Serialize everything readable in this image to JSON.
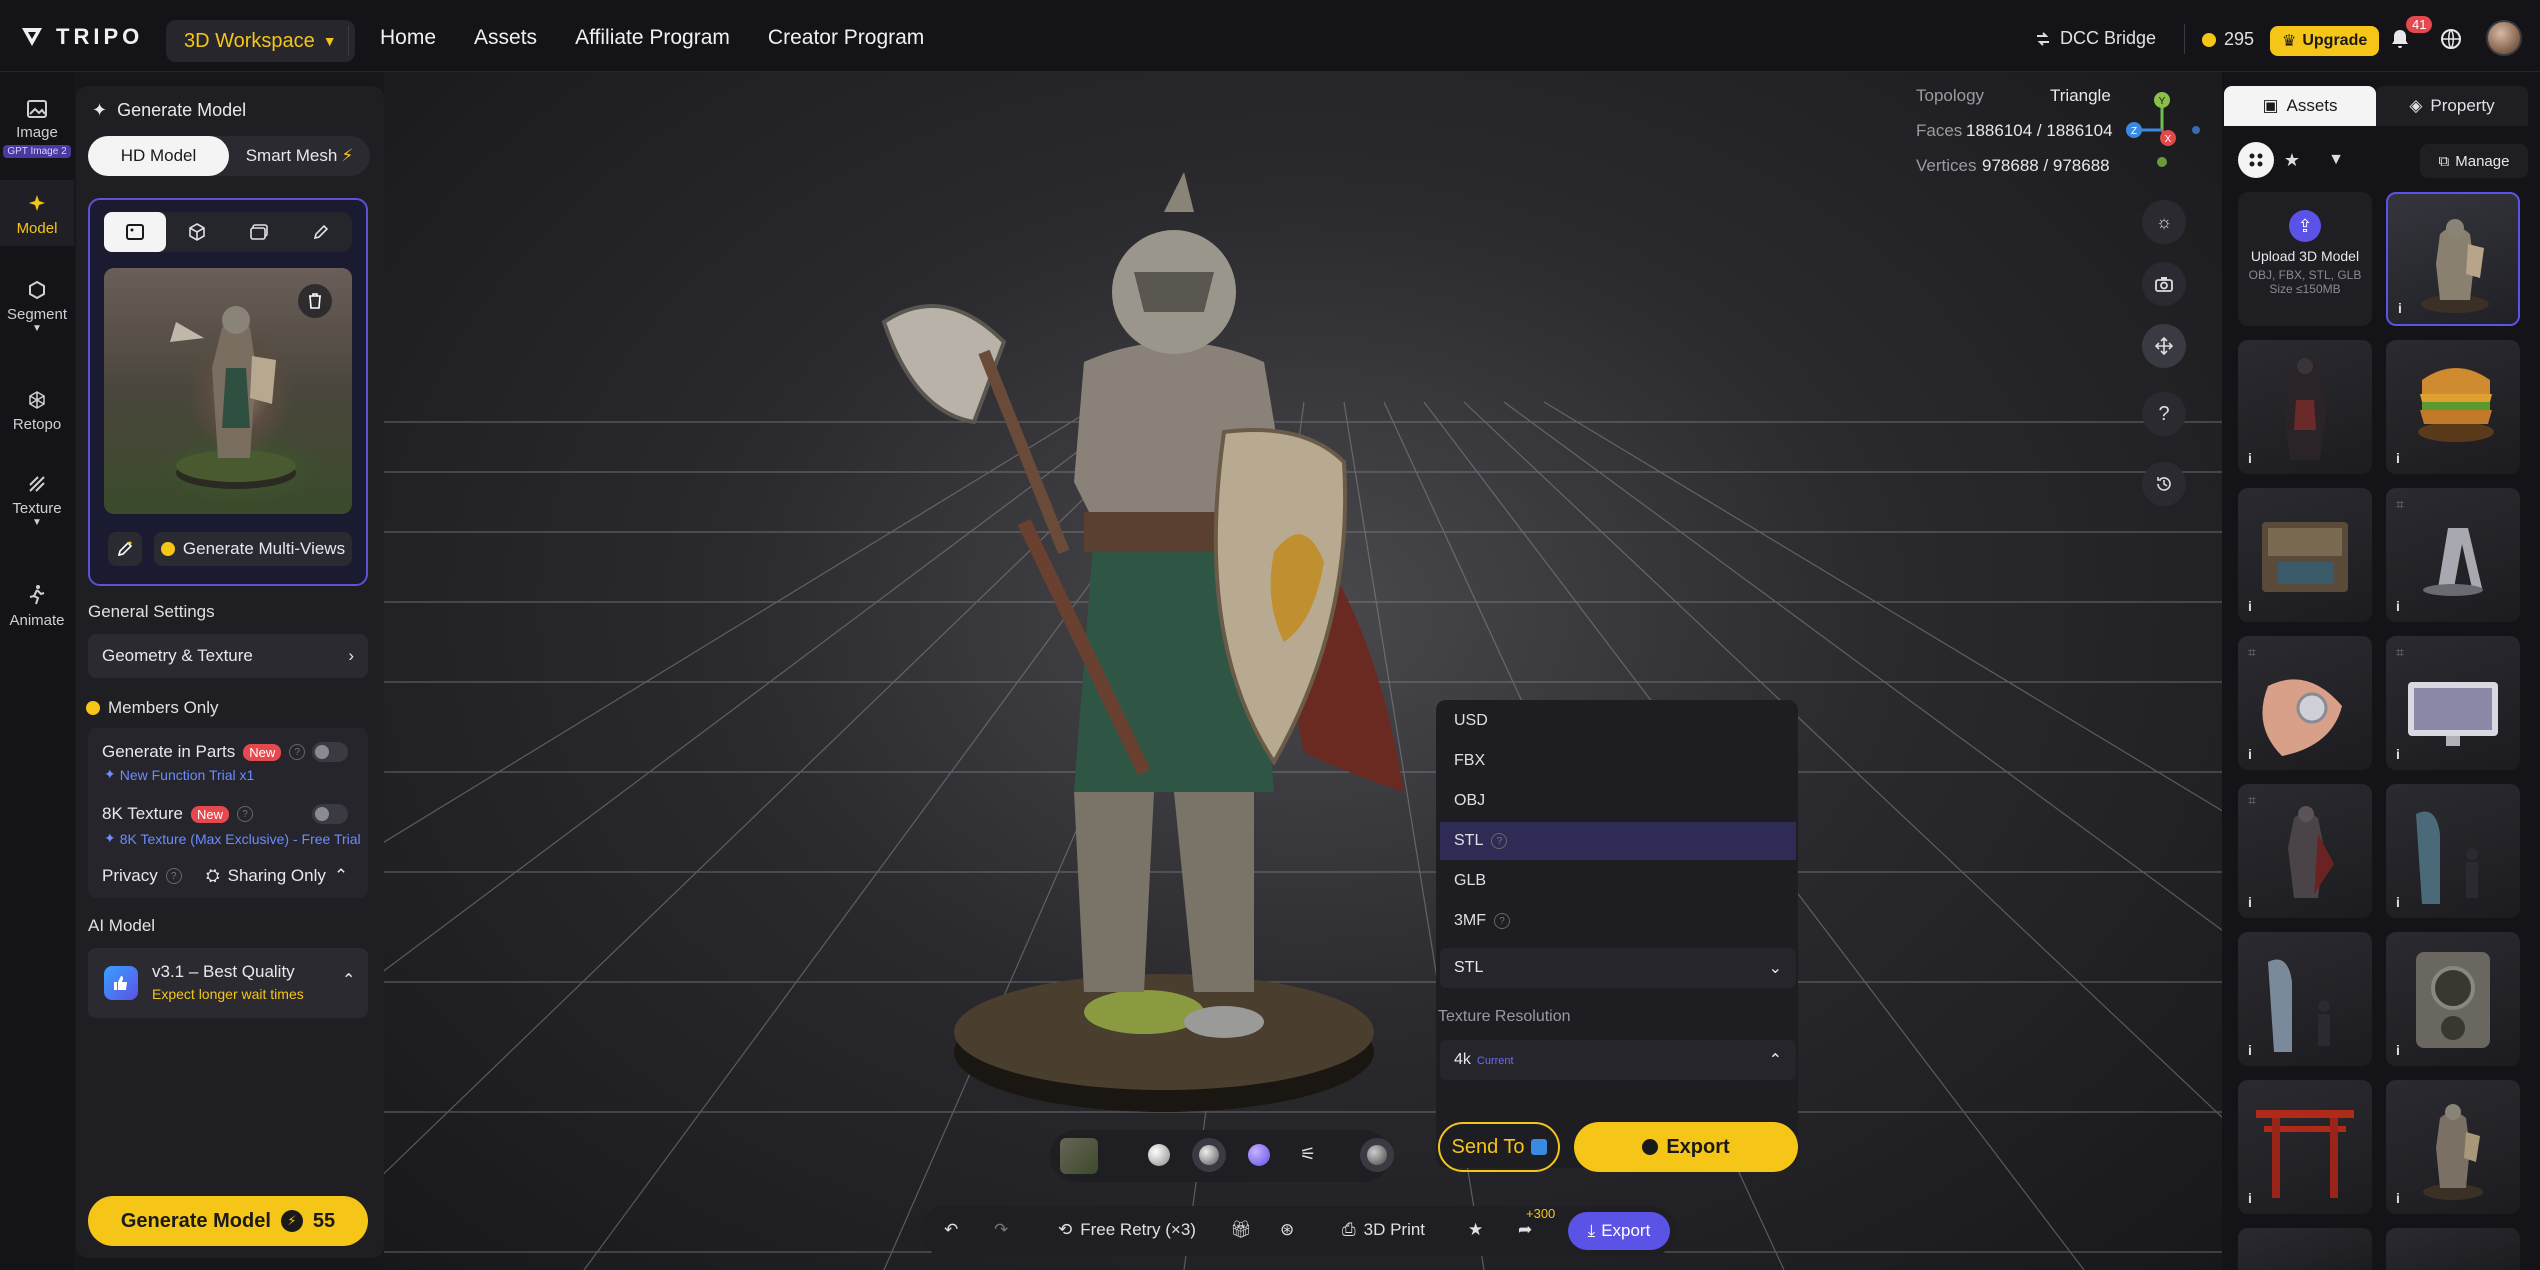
{
  "brand": {
    "name": "TRIPO"
  },
  "workspace": {
    "label": "3D Workspace"
  },
  "nav": {
    "home": "Home",
    "assets": "Assets",
    "affiliate": "Affiliate Program",
    "creator": "Creator Program"
  },
  "topright": {
    "dcc": "DCC Bridge",
    "credits": "295",
    "upgrade": "Upgrade",
    "notifications": "41"
  },
  "rail": {
    "image": "Image",
    "image_tag": "GPT Image 2",
    "model": "Model",
    "segment": "Segment",
    "retopo": "Retopo",
    "texture": "Texture",
    "animate": "Animate"
  },
  "panel": {
    "title": "Generate Model",
    "mode_hd": "HD Model",
    "mode_smart": "Smart Mesh",
    "multiview": "Generate Multi-Views",
    "general_settings": "General Settings",
    "geometry": "Geometry & Texture",
    "members_only": "Members Only",
    "parts_label": "Generate in Parts",
    "parts_new": "New",
    "parts_note": "New Function Trial x1",
    "tex8k_label": "8K Texture",
    "tex8k_new": "New",
    "tex8k_note": "8K Texture (Max Exclusive) - Free Trial",
    "privacy": "Privacy",
    "sharing": "Sharing Only",
    "ai_model": "AI Model",
    "model_name": "v3.1 – Best Quality",
    "model_note": "Expect longer wait times",
    "generate": "Generate Model",
    "generate_cost": "55"
  },
  "stats": {
    "topology_label": "Topology",
    "topology": "Triangle",
    "faces_label": "Faces",
    "faces": "1886104 / 1886104",
    "vertices_label": "Vertices",
    "vertices": "978688 / 978688"
  },
  "axes": {
    "y": "Y",
    "z": "Z",
    "x": "X"
  },
  "export": {
    "formats": [
      {
        "label": "USD",
        "help": false,
        "selected": false
      },
      {
        "label": "FBX",
        "help": false,
        "selected": false
      },
      {
        "label": "OBJ",
        "help": false,
        "selected": false
      },
      {
        "label": "STL",
        "help": true,
        "selected": true
      },
      {
        "label": "GLB",
        "help": false,
        "selected": false
      },
      {
        "label": "3MF",
        "help": true,
        "selected": false
      }
    ],
    "current_format": "STL",
    "texture_resolution_label": "Texture Resolution",
    "texture_resolution": "4k",
    "texture_resolution_tag": "Current",
    "send_to": "Send To",
    "export_btn": "Export"
  },
  "toolbar": {
    "free_retry": "Free Retry (×3)",
    "print": "3D Print",
    "plus": "+300",
    "export": "Export"
  },
  "right": {
    "tab_assets": "Assets",
    "tab_property": "Property",
    "manage": "Manage",
    "upload_title": "Upload 3D Model",
    "upload_formats": "OBJ, FBX, STL, GLB",
    "upload_size": "Size ≤150MB",
    "info": "i"
  },
  "colors": {
    "accent": "#f5c518",
    "primary": "#5b52e6",
    "panel": "#1e1e23",
    "bg": "#141418"
  }
}
